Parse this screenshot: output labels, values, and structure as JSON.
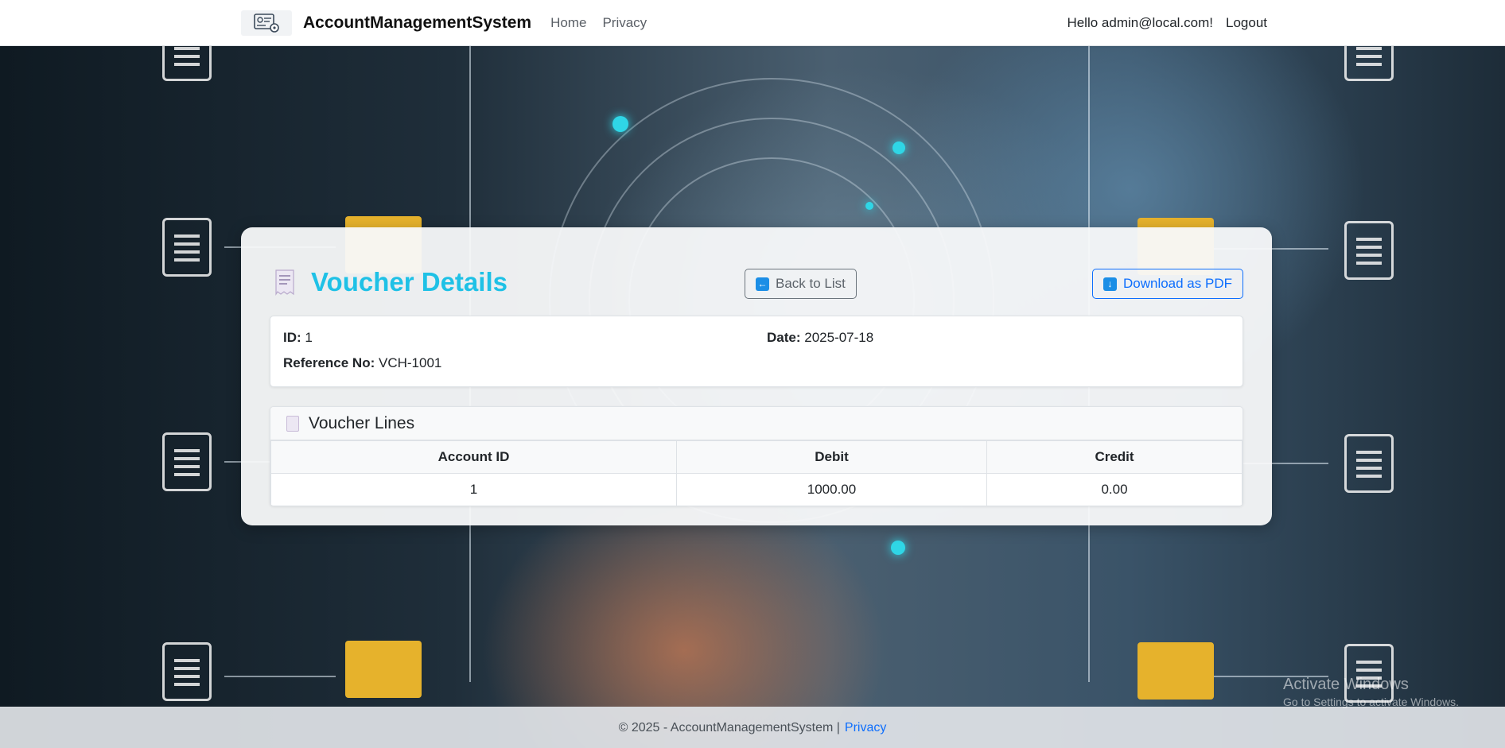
{
  "navbar": {
    "brand": "AccountManagementSystem",
    "links": [
      "Home",
      "Privacy"
    ],
    "greeting": "Hello admin@local.com!",
    "logout": "Logout"
  },
  "page": {
    "title": "Voucher Details",
    "back_label": "Back to List",
    "pdf_label": "Download as PDF"
  },
  "voucher": {
    "id_label": "ID:",
    "id_value": "1",
    "date_label": "Date:",
    "date_value": "2025-07-18",
    "ref_label": "Reference No:",
    "ref_value": "VCH-1001"
  },
  "lines": {
    "title": "Voucher Lines",
    "columns": [
      "Account ID",
      "Debit",
      "Credit"
    ],
    "rows": [
      [
        "1",
        "1000.00",
        "0.00"
      ]
    ]
  },
  "footer": {
    "text": "© 2025 - AccountManagementSystem |",
    "link": "Privacy"
  },
  "watermark": {
    "line1": "Activate Windows",
    "line2": "Go to Settings to activate Windows."
  },
  "colors": {
    "title": "#1fc1e6",
    "primary": "#0d6efd",
    "secondary": "#6c757d"
  }
}
